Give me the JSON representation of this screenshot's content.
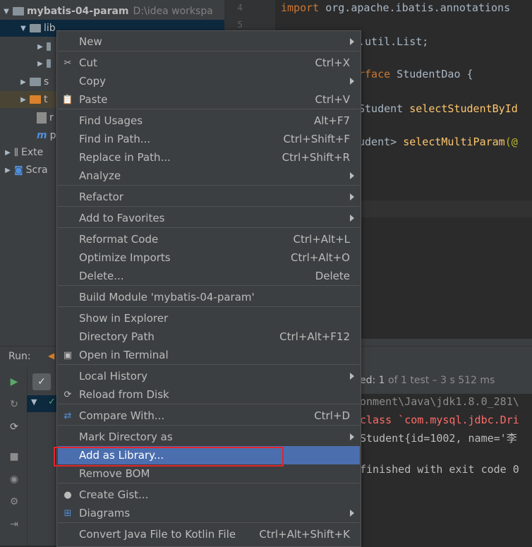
{
  "project": {
    "root_name": "mybatis-04-param",
    "root_path": "D:\\idea workspa",
    "lib_label": "lib",
    "ext_label": "Exte",
    "scratch_label": "Scra",
    "truncated_s": "s",
    "truncated_t": "t",
    "truncated_r": "r",
    "truncated_p": "p"
  },
  "gutter": {
    "lines": [
      "4",
      "5"
    ]
  },
  "editor": {
    "import_kw": "import",
    "import_rest": " org.apache.ibatis.annotations",
    "list_import": ".util.List;",
    "iface_kw": "rface",
    "iface_name": " StudentDao {",
    "method1_type": "Student ",
    "method1_name": "selectStudentById",
    "method2_type": "udent> ",
    "method2_name": "selectMultiParam",
    "method2_tail": "(@",
    "method2_cont": "@"
  },
  "run": {
    "label": "Run:",
    "test_status_prefix": "ed: ",
    "test_status_count": "1",
    "test_status_rest": " of 1 test – 3 s 512 ms",
    "console_lines": [
      "onment\\Java\\jdk1.8.0_281\\",
      "class `com.mysql.jdbc.Dri",
      "Student{id=1002, name='李",
      "",
      "finished with exit code 0"
    ]
  },
  "menu": {
    "items": [
      {
        "label": "New",
        "shortcut": "",
        "submenu": true,
        "icon": ""
      },
      {
        "label": "Cut",
        "shortcut": "Ctrl+X",
        "submenu": false,
        "icon": "scissors-icon"
      },
      {
        "label": "Copy",
        "shortcut": "",
        "submenu": true,
        "icon": ""
      },
      {
        "label": "Paste",
        "shortcut": "Ctrl+V",
        "submenu": false,
        "icon": "clipboard-icon"
      },
      {
        "label": "Find Usages",
        "shortcut": "Alt+F7",
        "submenu": false,
        "icon": ""
      },
      {
        "label": "Find in Path...",
        "shortcut": "Ctrl+Shift+F",
        "submenu": false,
        "icon": ""
      },
      {
        "label": "Replace in Path...",
        "shortcut": "Ctrl+Shift+R",
        "submenu": false,
        "icon": ""
      },
      {
        "label": "Analyze",
        "shortcut": "",
        "submenu": true,
        "icon": ""
      },
      {
        "label": "Refactor",
        "shortcut": "",
        "submenu": true,
        "icon": ""
      },
      {
        "label": "Add to Favorites",
        "shortcut": "",
        "submenu": true,
        "icon": ""
      },
      {
        "label": "Reformat Code",
        "shortcut": "Ctrl+Alt+L",
        "submenu": false,
        "icon": ""
      },
      {
        "label": "Optimize Imports",
        "shortcut": "Ctrl+Alt+O",
        "submenu": false,
        "icon": ""
      },
      {
        "label": "Delete...",
        "shortcut": "Delete",
        "submenu": false,
        "icon": ""
      },
      {
        "label": "Build Module 'mybatis-04-param'",
        "shortcut": "",
        "submenu": false,
        "icon": ""
      },
      {
        "label": "Show in Explorer",
        "shortcut": "",
        "submenu": false,
        "icon": ""
      },
      {
        "label": "Directory Path",
        "shortcut": "Ctrl+Alt+F12",
        "submenu": false,
        "icon": ""
      },
      {
        "label": "Open in Terminal",
        "shortcut": "",
        "submenu": false,
        "icon": "terminal-icon"
      },
      {
        "label": "Local History",
        "shortcut": "",
        "submenu": true,
        "icon": ""
      },
      {
        "label": "Reload from Disk",
        "shortcut": "",
        "submenu": false,
        "icon": "reload-icon"
      },
      {
        "label": "Compare With...",
        "shortcut": "Ctrl+D",
        "submenu": false,
        "icon": "compare-icon"
      },
      {
        "label": "Mark Directory as",
        "shortcut": "",
        "submenu": true,
        "icon": ""
      },
      {
        "label": "Add as Library...",
        "shortcut": "",
        "submenu": false,
        "icon": "",
        "active": true
      },
      {
        "label": "Remove BOM",
        "shortcut": "",
        "submenu": false,
        "icon": ""
      },
      {
        "label": "Create Gist...",
        "shortcut": "",
        "submenu": false,
        "icon": "github-icon"
      },
      {
        "label": "Diagrams",
        "shortcut": "",
        "submenu": true,
        "icon": "diagram-icon"
      },
      {
        "label": "Convert Java File to Kotlin File",
        "shortcut": "Ctrl+Alt+Shift+K",
        "submenu": false,
        "icon": ""
      }
    ]
  },
  "colors": {
    "accent": "#4b6eaf",
    "highlight_border": "#e5252b",
    "panel": "#3c3f41",
    "editor_bg": "#2b2b2b"
  }
}
